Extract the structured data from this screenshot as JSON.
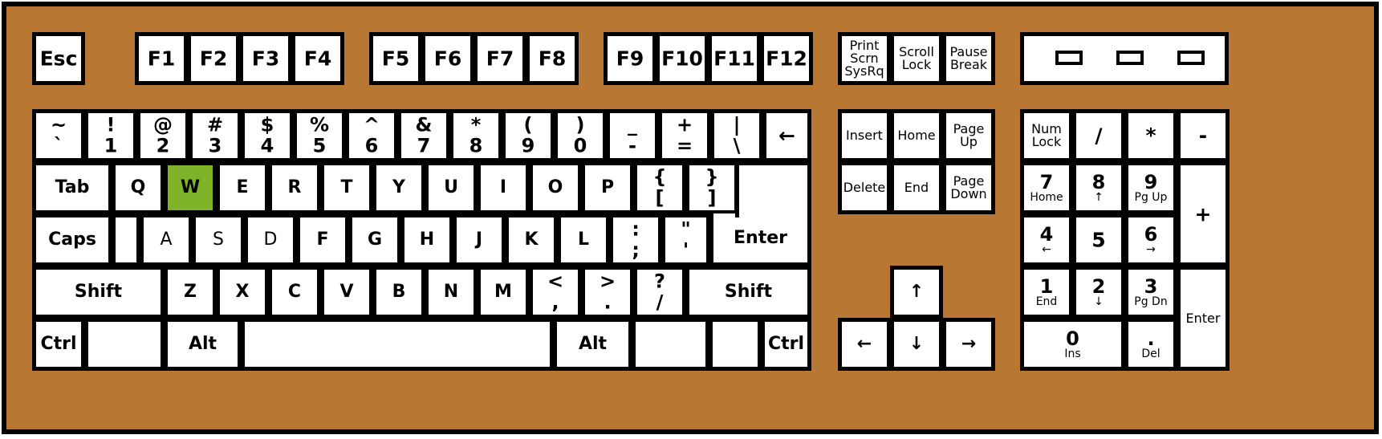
{
  "colors": {
    "case": "#b87733",
    "key": "#ffffff",
    "outline": "#000000",
    "highlight": "#7fb32a"
  },
  "function_row": [
    {
      "id": "esc",
      "label": "Esc"
    },
    {
      "id": "f1",
      "label": "F1"
    },
    {
      "id": "f2",
      "label": "F2"
    },
    {
      "id": "f3",
      "label": "F3"
    },
    {
      "id": "f4",
      "label": "F4"
    },
    {
      "id": "f5",
      "label": "F5"
    },
    {
      "id": "f6",
      "label": "F6"
    },
    {
      "id": "f7",
      "label": "F7"
    },
    {
      "id": "f8",
      "label": "F8"
    },
    {
      "id": "f9",
      "label": "F9"
    },
    {
      "id": "f10",
      "label": "F10"
    },
    {
      "id": "f11",
      "label": "F11"
    },
    {
      "id": "f12",
      "label": "F12"
    },
    {
      "id": "print",
      "label": "Print\nScrn\nSysRq"
    },
    {
      "id": "scroll",
      "label": "Scroll\nLock"
    },
    {
      "id": "pause",
      "label": "Pause\nBreak"
    }
  ],
  "number_row": [
    {
      "top": "~",
      "bottom": "`"
    },
    {
      "top": "!",
      "bottom": "1"
    },
    {
      "top": "@",
      "bottom": "2"
    },
    {
      "top": "#",
      "bottom": "3"
    },
    {
      "top": "$",
      "bottom": "4"
    },
    {
      "top": "%",
      "bottom": "5"
    },
    {
      "top": "^",
      "bottom": "6"
    },
    {
      "top": "&",
      "bottom": "7"
    },
    {
      "top": "*",
      "bottom": "8"
    },
    {
      "top": "(",
      "bottom": "9"
    },
    {
      "top": ")",
      "bottom": "0"
    },
    {
      "top": "_",
      "bottom": "-"
    },
    {
      "top": "+",
      "bottom": "="
    },
    {
      "top": "|",
      "bottom": "\\"
    },
    {
      "top": "←",
      "bottom": ""
    }
  ],
  "qwerty_row": [
    "Tab",
    "Q",
    "W",
    "E",
    "R",
    "T",
    "Y",
    "U",
    "I",
    "O",
    "P",
    {
      "top": "{",
      "bottom": "["
    },
    {
      "top": "}",
      "bottom": "]"
    }
  ],
  "home_row": [
    "Caps",
    "",
    "A",
    "S",
    "D",
    "F",
    "G",
    "H",
    "J",
    "K",
    "L",
    {
      "top": ":",
      "bottom": ";"
    },
    {
      "top": "\"",
      "bottom": "'"
    },
    "Enter"
  ],
  "shift_row": [
    "Shift",
    "Z",
    "X",
    "C",
    "V",
    "B",
    "N",
    "M",
    {
      "top": "<",
      "bottom": ","
    },
    {
      "top": ">",
      "bottom": "."
    },
    {
      "top": "?",
      "bottom": "/"
    },
    "Shift"
  ],
  "bottom_row": [
    "Ctrl",
    "",
    "Alt",
    "",
    "Alt",
    "",
    "",
    "Ctrl"
  ],
  "nav_cluster": [
    "Insert",
    "Home",
    "Page\nUp",
    "Delete",
    "End",
    "Page\nDown"
  ],
  "arrows": {
    "up": "↑",
    "left": "←",
    "down": "↓",
    "right": "→"
  },
  "numpad": [
    {
      "top": "Num\nLock",
      "bottom": ""
    },
    {
      "top": "/",
      "bottom": ""
    },
    {
      "top": "*",
      "bottom": ""
    },
    {
      "top": "-",
      "bottom": ""
    },
    {
      "top": "7",
      "bottom": "Home"
    },
    {
      "top": "8",
      "bottom": "↑"
    },
    {
      "top": "9",
      "bottom": "Pg Up"
    },
    {
      "top": "+",
      "bottom": ""
    },
    {
      "top": "4",
      "bottom": "←"
    },
    {
      "top": "5",
      "bottom": ""
    },
    {
      "top": "6",
      "bottom": "→"
    },
    {
      "top": "1",
      "bottom": "End"
    },
    {
      "top": "2",
      "bottom": "↓"
    },
    {
      "top": "3",
      "bottom": "Pg Dn"
    },
    {
      "top": "Enter",
      "bottom": ""
    },
    {
      "top": "0",
      "bottom": "Ins"
    },
    {
      "top": ".",
      "bottom": "Del"
    }
  ],
  "highlighted_key": "W"
}
